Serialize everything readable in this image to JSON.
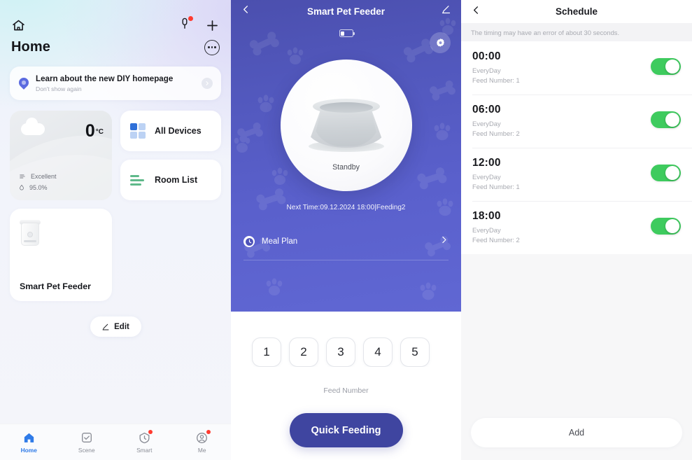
{
  "colors": {
    "accent_purple": "#5a60cc",
    "accent_purple_dark": "#3f45a0",
    "toggle_green": "#3ecb5e",
    "tab_active_blue": "#2f7be8",
    "badge_red": "#ff3b30"
  },
  "home": {
    "icons": {
      "home": "home-icon",
      "mic": "microphone-icon",
      "add": "plus-icon",
      "more": "more-options-icon"
    },
    "title": "Home",
    "banner": {
      "title": "Learn about the new DIY homepage",
      "subtitle": "Don't show again",
      "icon": "pin-icon",
      "chevron": "chevron-right-icon"
    },
    "weather": {
      "temperature": "0",
      "unit": "°C",
      "icon": "cloud-icon",
      "air_quality_icon": "air-quality-icon",
      "air_quality": "Excellent",
      "humidity_icon": "humidity-drop-icon",
      "humidity": "95.0%"
    },
    "shortcuts": [
      {
        "label": "All Devices",
        "icon": "grid-icon"
      },
      {
        "label": "Room List",
        "icon": "list-lines-icon"
      }
    ],
    "device": {
      "name": "Smart Pet Feeder",
      "icon": "pet-feeder-thumbnail"
    },
    "edit": {
      "label": "Edit",
      "icon": "pencil-icon"
    },
    "tabs": [
      {
        "label": "Home",
        "icon": "home-icon",
        "active": true,
        "badge": false
      },
      {
        "label": "Scene",
        "icon": "check-square-icon",
        "active": false,
        "badge": false
      },
      {
        "label": "Smart",
        "icon": "smart-clock-icon",
        "active": false,
        "badge": true
      },
      {
        "label": "Me",
        "icon": "person-circle-icon",
        "active": false,
        "badge": true
      }
    ]
  },
  "device": {
    "back_icon": "back-chevron-icon",
    "title": "Smart Pet Feeder",
    "edit_icon": "pencil-icon",
    "battery_icon": "battery-icon",
    "settings_icon": "gear-icon",
    "status": "Standby",
    "next_time": "Next Time:09.12.2024 18:00|Feeding2",
    "meal_plan": {
      "label": "Meal Plan",
      "icon": "clock-icon",
      "chevron": "chevron-right-icon"
    },
    "feed_numbers": [
      "1",
      "2",
      "3",
      "4",
      "5"
    ],
    "feed_caption": "Feed Number",
    "quick_feeding": "Quick Feeding"
  },
  "schedule": {
    "back_icon": "back-chevron-icon",
    "title": "Schedule",
    "note": "The timing may have an error of about 30 seconds.",
    "items": [
      {
        "time": "00:00",
        "repeat": "EveryDay",
        "feed": "Feed Number: 1",
        "enabled": true
      },
      {
        "time": "06:00",
        "repeat": "EveryDay",
        "feed": "Feed Number: 2",
        "enabled": true
      },
      {
        "time": "12:00",
        "repeat": "EveryDay",
        "feed": "Feed Number: 1",
        "enabled": true
      },
      {
        "time": "18:00",
        "repeat": "EveryDay",
        "feed": "Feed Number: 2",
        "enabled": true
      }
    ],
    "add_label": "Add"
  }
}
